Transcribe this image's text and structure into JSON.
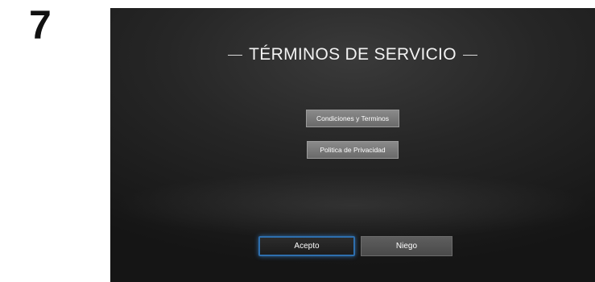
{
  "step": {
    "number": "7"
  },
  "screen": {
    "title": "TÉRMINOS DE SERVICIO",
    "buttons": {
      "conditions": "Condiciones y Terminos",
      "privacy": "Politica de Privacidad",
      "accept": "Acepto",
      "deny": "Niego"
    },
    "focused_button": "accept"
  },
  "colors": {
    "focus_outline": "#2e6fae",
    "background": "#262626"
  }
}
